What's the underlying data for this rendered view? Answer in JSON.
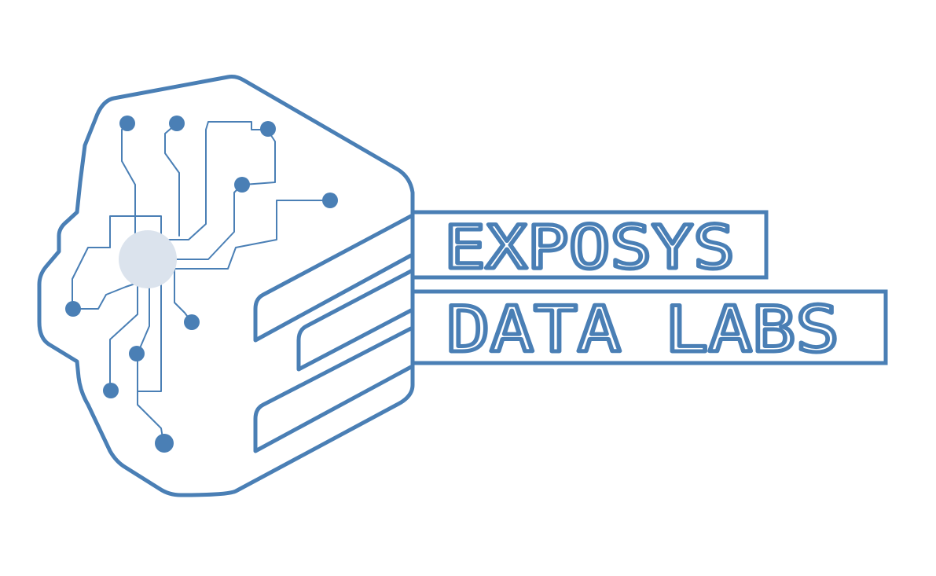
{
  "logo": {
    "brand_line_1": "EXPOSYS",
    "brand_line_2": "DATA LABS",
    "colors": {
      "primary": "#4a7fb5",
      "chip_fill": "#dbe3ed",
      "background": "#ffffff"
    }
  }
}
